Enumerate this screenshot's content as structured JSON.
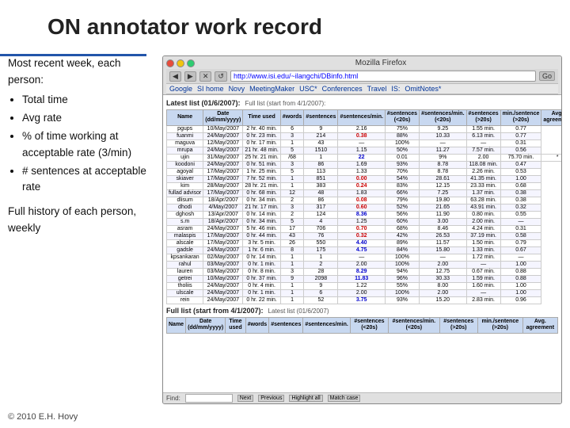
{
  "title": "ON annotator work record",
  "left_panel": {
    "intro": "Most recent week, each person:",
    "bullets": [
      "Total time",
      "Avg rate",
      "% of time working at acceptable rate (3/min)",
      "# sentences at acceptable rate"
    ],
    "full_history": "Full history of each person, weekly"
  },
  "copyright": "© 2010  E.H. Hovy",
  "browser": {
    "title": "Mozilla Firefox",
    "address": "http://www.isi.edu/~ilangchi/DBinfo.html",
    "bookmarks": [
      "Google",
      "SI home",
      "Novy",
      "MeetingMaker",
      "USC*",
      "Conferences",
      "Travel",
      "IS:",
      "OmitNotes*"
    ],
    "nav_buttons": [
      "◀",
      "▶",
      "✕",
      "↺"
    ],
    "table1_title": "Latest list (01/6/2007):",
    "table1_subtitle": "Full list (start from 4/1/2007):",
    "table2_title": "Full list (start from 4/1/2007):",
    "table2_subtitle": "Latest list (01/6/2007)",
    "col_headers": [
      "Name",
      "Date (dd/mm/yyyy)",
      "Time used",
      "#words",
      "#sentences",
      "#sentences/min.",
      "#sentences (<20s)",
      "#sentences/min. (<20s)",
      "#sentences (>20s)",
      "min./sentence (>20s)",
      "Avg. agreement"
    ],
    "rows1": [
      [
        "pgups",
        "10/May/2007",
        "2 hr. 40 min.",
        "6",
        "9",
        "2.16",
        "75%",
        "9.25",
        "1.55 min.",
        "0.77"
      ],
      [
        "fuanmi",
        "24/May/2007",
        "0 hr. 23 min.",
        "3",
        "214",
        "0.38",
        "88%",
        "10.33",
        "6.13 min.",
        "0.77"
      ],
      [
        "maguva",
        "12/May/2007",
        "0 hr. 17 min.",
        "1",
        "43",
        "—",
        "100%",
        "—",
        "—",
        "0.31"
      ],
      [
        "mrupa",
        "24/May/2007",
        "21 hr. 48 min.",
        "5",
        "1510",
        "1.15",
        "50%",
        "11.27",
        "7.57 min.",
        "0.56"
      ],
      [
        "ujin",
        "31/May/2007",
        "25 hr. 21 min.",
        "/68",
        "1",
        "22",
        "0.01",
        "9%",
        "2.00",
        "75.70 min.",
        "*"
      ],
      [
        "koodoni",
        "24/May/2007",
        "0 hr. 51 min.",
        "3",
        "86",
        "1.69",
        "93%",
        "8.78",
        "118.08 min.",
        "0.47"
      ],
      [
        "agoyal",
        "17/May/2007",
        "1 hr. 25 min.",
        "5",
        "113",
        "1.33",
        "70%",
        "8.78",
        "2.26 min.",
        "0.53"
      ],
      [
        "skiaver",
        "17/May/2007",
        "7 hr. 52 min.",
        "1",
        "851",
        "0.00",
        "54%",
        "28.61",
        "41.35 min.",
        "1.00"
      ],
      [
        "kim",
        "28/May/2007",
        "28 hr. 21 min.",
        "1",
        "383",
        "0.24",
        "83%",
        "12.15",
        "23.33 min.",
        "0.68"
      ],
      [
        "fullad advisor",
        "17/May/2007",
        "0 hr. 68 min.",
        "12",
        "48",
        "1.83",
        "66%",
        "7.25",
        "1.37 min.",
        "0.38"
      ],
      [
        "dlisum",
        "18/Apr/2007",
        "0 hr. 34 min.",
        "2",
        "86",
        "0.08",
        "79%",
        "19.80",
        "63.28 min.",
        "0.38"
      ],
      [
        "dhodi",
        "4/May/2007",
        "21 hr. 17 min.",
        "3",
        "317",
        "0.60",
        "52%",
        "21.65",
        "43.91 min.",
        "0.32"
      ],
      [
        "dghosh",
        "13/Apr/2007",
        "0 hr. 14 min.",
        "2",
        "124",
        "8.36",
        "56%",
        "11.90",
        "0.80 min.",
        "0.55"
      ],
      [
        "s.m",
        "18/Apr/2007",
        "0 hr. 34 min.",
        "5",
        "4",
        "1.25",
        "60%",
        "3.00",
        "2.00 min.",
        "—"
      ],
      [
        "asram",
        "24/May/2007",
        "5 hr. 46 min.",
        "17",
        "706",
        "0.70",
        "68%",
        "8.46",
        "4.24 min.",
        "0.31"
      ],
      [
        "malaspis",
        "17/May/2007",
        "0 hr. 44 min.",
        "43",
        "76",
        "0.32",
        "42%",
        "26.53",
        "37.19 min.",
        "0.58"
      ],
      [
        "alscale",
        "17/May/2007",
        "3 hr. 5 min.",
        "26",
        "550",
        "4.40",
        "89%",
        "11.57",
        "1.50 min.",
        "0.79"
      ],
      [
        "gadsle",
        "24/May/2007",
        "1 hr. 6 min.",
        "8",
        "175",
        "4.75",
        "84%",
        "15.80",
        "1.33 min.",
        "0.67"
      ],
      [
        "kpsankaran",
        "02/May/2007",
        "0 hr. 14 min.",
        "1",
        "1",
        "—",
        "100%",
        "—",
        "1.72 min.",
        "—"
      ],
      [
        "rahul",
        "03/May/2007",
        "0 hr. 1 min.",
        "1",
        "2",
        "2.00",
        "100%",
        "2.00",
        "—",
        "1.00"
      ],
      [
        "lauren",
        "03/May/2007",
        "0 hr. 8 min.",
        "3",
        "28",
        "8.29",
        "94%",
        "12.75",
        "0.67 min.",
        "0.88"
      ],
      [
        "getrei",
        "10/May/2007",
        "0 hr. 37 min.",
        "9",
        "2098",
        "11.83",
        "96%",
        "30.33",
        "1.59 min.",
        "0.88"
      ],
      [
        "tholiis",
        "24/May/2007",
        "0 hr. 4 min.",
        "1",
        "9",
        "1.22",
        "55%",
        "8.00",
        "1.60 min.",
        "1.00"
      ],
      [
        "ulscale",
        "24/May/2007",
        "0 hr. 1 min.",
        "1",
        "6",
        "2.00",
        "100%",
        "2.00",
        "—",
        "1.00"
      ],
      [
        "rein",
        "24/May/2007",
        "0 hr. 22 min.",
        "1",
        "52",
        "3.75",
        "93%",
        "15.20",
        "2.83 min.",
        "0.96"
      ]
    ],
    "status_bar": {
      "find_label": "Find:",
      "find_placeholder": "",
      "buttons": [
        "Next",
        "Previous",
        "Highlight all",
        "Match case"
      ]
    }
  }
}
